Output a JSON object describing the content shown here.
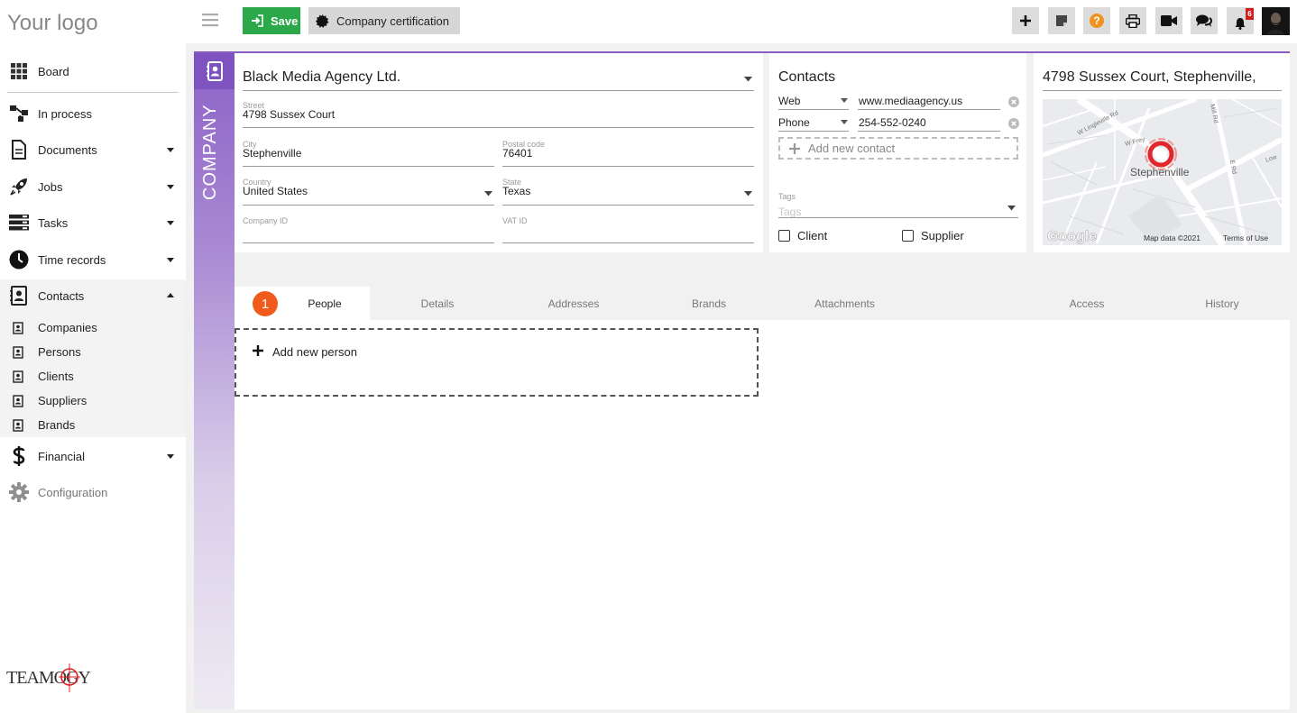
{
  "app": {
    "logo_text": "Your logo"
  },
  "sidebar": {
    "items": [
      {
        "label": "Board",
        "icon": "grid-icon"
      },
      {
        "label": "In process",
        "icon": "workflow-icon"
      },
      {
        "label": "Documents",
        "icon": "document-icon"
      },
      {
        "label": "Jobs",
        "icon": "rocket-icon"
      },
      {
        "label": "Tasks",
        "icon": "tasks-icon"
      },
      {
        "label": "Time records",
        "icon": "clock-icon"
      },
      {
        "label": "Contacts",
        "icon": "contact-book-icon"
      },
      {
        "label": "Financial",
        "icon": "dollar-icon"
      },
      {
        "label": "Configuration",
        "icon": "gear-icon"
      }
    ],
    "contacts_sub": [
      {
        "label": "Companies"
      },
      {
        "label": "Persons"
      },
      {
        "label": "Clients"
      },
      {
        "label": "Suppliers"
      },
      {
        "label": "Brands"
      }
    ],
    "footer_logo_text": "TEAMOGY"
  },
  "toolbar": {
    "save_label": "Save",
    "certification_label": "Company certification",
    "notification_count": "6"
  },
  "company": {
    "section_label": "COMPANY",
    "name": "Black Media Agency Ltd.",
    "street_label": "Street",
    "street": "4798  Sussex Court",
    "city_label": "City",
    "city": "Stephenville",
    "postal_label": "Postal code",
    "postal": "76401",
    "country_label": "Country",
    "country": "United States",
    "state_label": "State",
    "state": "Texas",
    "company_id_label": "Company ID",
    "company_id": "",
    "vat_label": "VAT ID",
    "vat": ""
  },
  "contacts": {
    "title": "Contacts",
    "rows": [
      {
        "type": "Web",
        "value": "www.mediaagency.us"
      },
      {
        "type": "Phone",
        "value": "254-552-0240"
      }
    ],
    "add_label": "Add new contact",
    "tags_label": "Tags",
    "tags_placeholder": "Tags",
    "client_label": "Client",
    "supplier_label": "Supplier"
  },
  "map": {
    "address": "4798 Sussex Court, Stephenville,",
    "city_label": "Stephenville",
    "streets": [
      "W Lingleville Rd",
      "W Frey",
      "Mill Rd",
      "E Rd",
      "Low"
    ],
    "google_label": "Google",
    "map_data_label": "Map data ©2021",
    "terms_label": "Terms of Use"
  },
  "tabs": {
    "badge": "1",
    "items": [
      {
        "label": "People"
      },
      {
        "label": "Details"
      },
      {
        "label": "Addresses"
      },
      {
        "label": "Brands"
      },
      {
        "label": "Attachments"
      },
      {
        "label": "Access"
      },
      {
        "label": "History"
      }
    ],
    "add_person_label": "Add new person"
  }
}
